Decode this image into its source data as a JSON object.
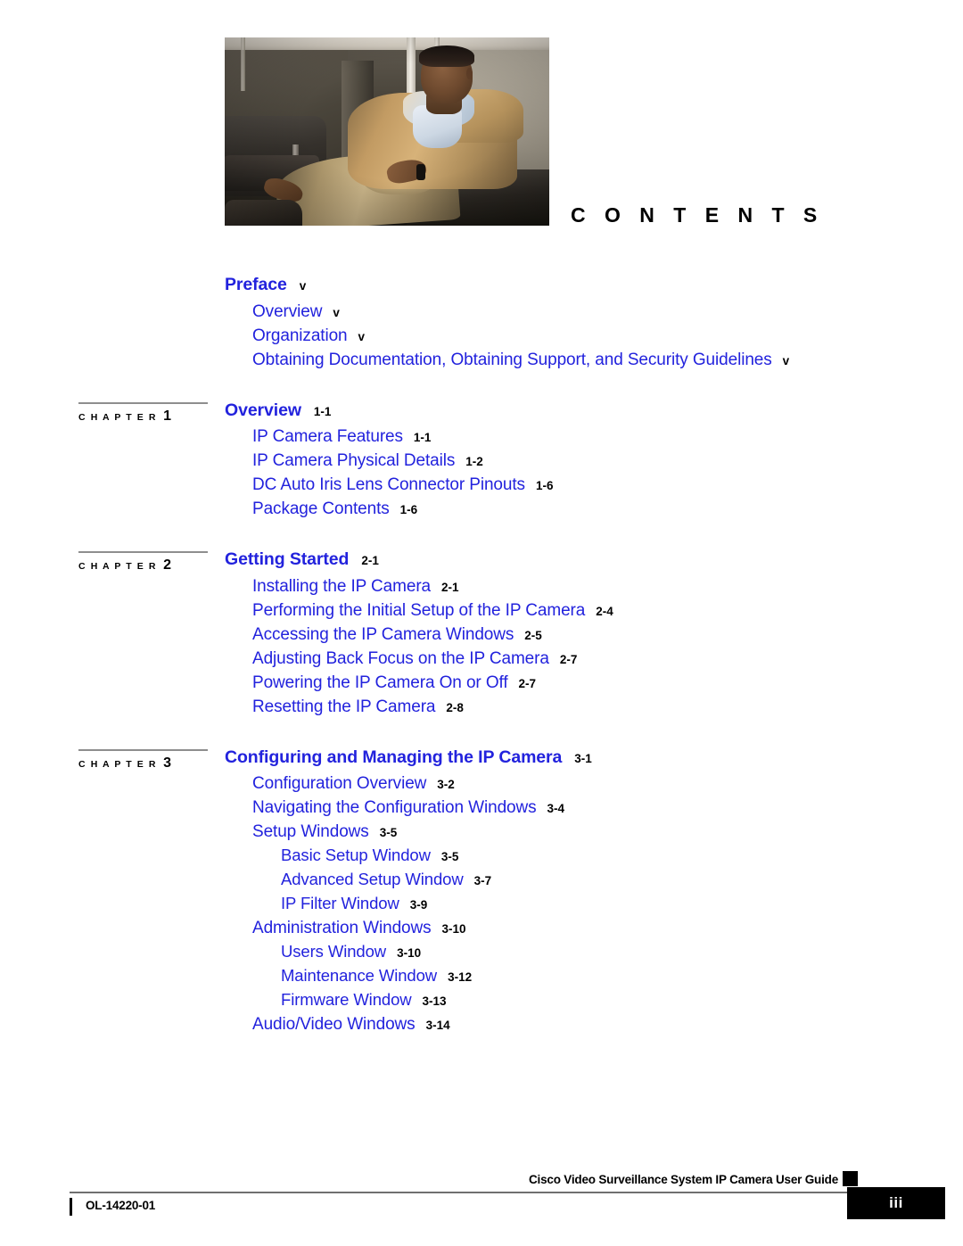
{
  "document": {
    "heading": "C O N T E N T S",
    "accent_blue": "#2222dd",
    "rule_gray": "#8e8e8e"
  },
  "hero": {
    "alt": "seated-man-in-tan-jacket-office-lobby"
  },
  "toc": {
    "groups": [
      {
        "chapter": null,
        "entries": [
          {
            "level": 1,
            "title": "Preface",
            "page": "v"
          },
          {
            "level": 2,
            "title": "Overview",
            "page": "v"
          },
          {
            "level": 2,
            "title": "Organization",
            "page": "v"
          },
          {
            "level": 2,
            "title": "Obtaining Documentation, Obtaining Support, and Security Guidelines",
            "page": "v"
          }
        ]
      },
      {
        "chapter": {
          "word": "C H A P T E R",
          "number": "1"
        },
        "entries": [
          {
            "level": 1,
            "title": "Overview",
            "page": "1-1"
          },
          {
            "level": 2,
            "title": "IP Camera Features",
            "page": "1-1"
          },
          {
            "level": 2,
            "title": "IP Camera Physical Details",
            "page": "1-2"
          },
          {
            "level": 2,
            "title": "DC Auto Iris Lens Connector Pinouts",
            "page": "1-6"
          },
          {
            "level": 2,
            "title": "Package Contents",
            "page": "1-6"
          }
        ]
      },
      {
        "chapter": {
          "word": "C H A P T E R",
          "number": "2"
        },
        "entries": [
          {
            "level": 1,
            "title": "Getting Started",
            "page": "2-1"
          },
          {
            "level": 2,
            "title": "Installing the IP Camera",
            "page": "2-1"
          },
          {
            "level": 2,
            "title": "Performing the Initial Setup of the IP Camera",
            "page": "2-4"
          },
          {
            "level": 2,
            "title": "Accessing the IP Camera Windows",
            "page": "2-5"
          },
          {
            "level": 2,
            "title": "Adjusting Back Focus on the IP Camera",
            "page": "2-7"
          },
          {
            "level": 2,
            "title": "Powering the IP Camera On or Off",
            "page": "2-7"
          },
          {
            "level": 2,
            "title": "Resetting the IP Camera",
            "page": "2-8"
          }
        ]
      },
      {
        "chapter": {
          "word": "C H A P T E R",
          "number": "3"
        },
        "entries": [
          {
            "level": 1,
            "title": "Configuring and Managing the IP Camera",
            "page": "3-1"
          },
          {
            "level": 2,
            "title": "Configuration Overview",
            "page": "3-2"
          },
          {
            "level": 2,
            "title": "Navigating the Configuration Windows",
            "page": "3-4"
          },
          {
            "level": 2,
            "title": "Setup Windows",
            "page": "3-5"
          },
          {
            "level": 3,
            "title": "Basic Setup Window",
            "page": "3-5"
          },
          {
            "level": 3,
            "title": "Advanced Setup Window",
            "page": "3-7"
          },
          {
            "level": 3,
            "title": "IP Filter Window",
            "page": "3-9"
          },
          {
            "level": 2,
            "title": "Administration Windows",
            "page": "3-10"
          },
          {
            "level": 3,
            "title": "Users Window",
            "page": "3-10"
          },
          {
            "level": 3,
            "title": "Maintenance Window",
            "page": "3-12"
          },
          {
            "level": 3,
            "title": "Firmware Window",
            "page": "3-13"
          },
          {
            "level": 2,
            "title": "Audio/Video Windows",
            "page": "3-14"
          }
        ]
      }
    ]
  },
  "footer": {
    "title": "Cisco Video Surveillance System IP Camera User Guide",
    "doc_id": "OL-14220-01",
    "page_number": "iii"
  }
}
